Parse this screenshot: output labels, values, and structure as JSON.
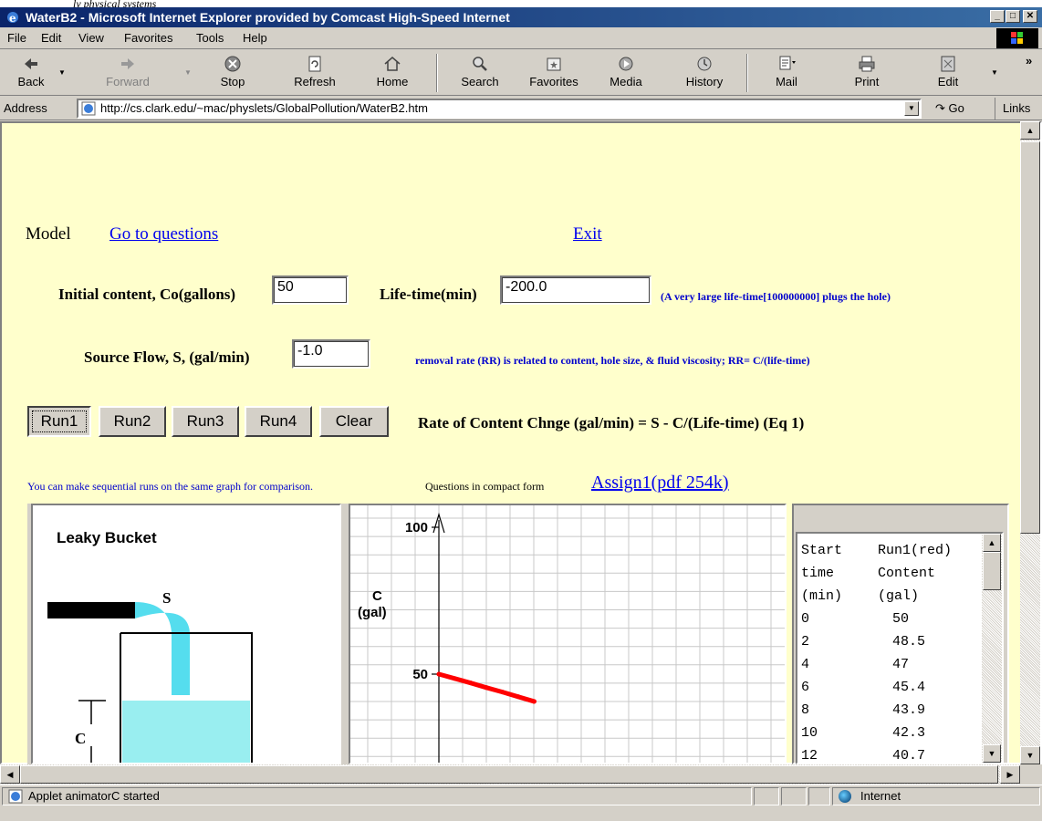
{
  "caption": "ly physical systems",
  "window": {
    "title": "WaterB2 - Microsoft Internet Explorer provided by Comcast High-Speed Internet",
    "minimize": "_",
    "maximize": "□",
    "close": "✕"
  },
  "menu": [
    "File",
    "Edit",
    "View",
    "Favorites",
    "Tools",
    "Help"
  ],
  "toolbar": {
    "back": "Back",
    "forward": "Forward",
    "stop": "Stop",
    "refresh": "Refresh",
    "home": "Home",
    "search": "Search",
    "favorites": "Favorites",
    "media": "Media",
    "history": "History",
    "mail": "Mail",
    "print": "Print",
    "edit": "Edit"
  },
  "address": {
    "label": "Address",
    "url": "http://cs.clark.edu/~mac/physlets/GlobalPollution/WaterB2.htm",
    "go": "Go",
    "links": "Links"
  },
  "page": {
    "model": "Model",
    "go_questions": "Go to questions",
    "exit": "Exit",
    "initial_label": "Initial content, Co(gallons)",
    "initial_value": "50",
    "lifetime_label": "Life-time(min)",
    "lifetime_value": "-200.0",
    "lifetime_note": "(A very large life-time[100000000]  plugs the hole)",
    "source_label": "Source Flow,  S, (gal/min)",
    "source_value": "-1.0",
    "removal_note": "removal rate (RR) is related to content, hole size, & fluid viscosity;   RR= C/(life-time)",
    "buttons": [
      "Run1",
      "Run2",
      "Run3",
      "Run4",
      "Clear"
    ],
    "equation": "Rate of Content Chnge (gal/min) = S - C/(Life-time)  (Eq 1)",
    "sequential_note": "You can make sequential runs on the same graph for comparison.",
    "compact_label": "Questions in compact form",
    "assign_link": "Assign1(pdf  254k)"
  },
  "bucket": {
    "title": "Leaky Bucket",
    "source_label": "S",
    "content_label": "C",
    "water_color": "#99eef0",
    "stream_color": "#55ddee"
  },
  "chart_data": {
    "type": "line",
    "y_label_top": "C",
    "y_label_bottom": "(gal)",
    "y_ticks": [
      "100",
      "50"
    ],
    "series": [
      {
        "color": "#ff0000",
        "x": [
          0,
          2,
          4,
          6,
          8,
          10,
          12
        ],
        "y": [
          50,
          48.5,
          47,
          45.4,
          43.9,
          42.3,
          40.7
        ]
      }
    ]
  },
  "table": {
    "header": [
      [
        "Start",
        "Run1(red)"
      ],
      [
        "time",
        "Content"
      ],
      [
        "(min)",
        "(gal)"
      ]
    ],
    "rows": [
      [
        "0",
        "50"
      ],
      [
        "2",
        "48.5"
      ],
      [
        "4",
        "47"
      ],
      [
        "6",
        "45.4"
      ],
      [
        "8",
        "43.9"
      ],
      [
        "10",
        "42.3"
      ],
      [
        "12",
        "40.7"
      ]
    ]
  },
  "status": {
    "text": "Applet animatorC started",
    "zone": "Internet"
  }
}
